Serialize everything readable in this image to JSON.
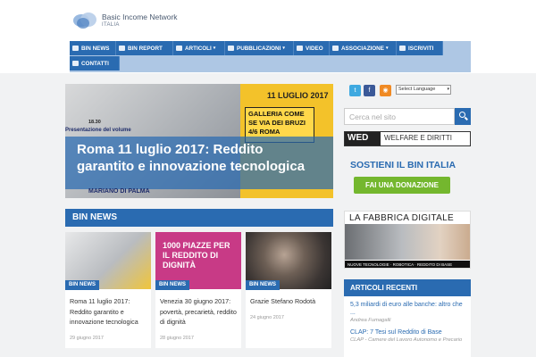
{
  "logo": {
    "line1": "Basic Income Network",
    "line2": "ITALIA"
  },
  "nav": {
    "items": [
      {
        "label": "BIN NEWS",
        "caret": ""
      },
      {
        "label": "BIN REPORT",
        "caret": ""
      },
      {
        "label": "ARTICOLI",
        "caret": "▾"
      },
      {
        "label": "PUBBLICAZIONI",
        "caret": "▾"
      },
      {
        "label": "VIDEO",
        "caret": ""
      },
      {
        "label": "ASSOCIAZIONE",
        "caret": "▾"
      },
      {
        "label": "ISCRIVITI",
        "caret": ""
      },
      {
        "label": "CONTATTI",
        "caret": ""
      }
    ]
  },
  "hero": {
    "title": "Roma 11 luglio 2017: Reddito garantito e innovazione tecnologica",
    "poster_date": "11 LUGLIO 2017",
    "poster_box": "GALLERIA COME SE VIA DEI BRUZI 4/6 ROMA",
    "poster_time": "18.30",
    "poster_line": "Presentazione del volume ",
    "poster_bottom": "MARIANO DI PALMA"
  },
  "section": {
    "bin_news": "BIN NEWS"
  },
  "cards": [
    {
      "tag": "BIN NEWS",
      "title": "Roma 11 luglio 2017: Reddito garantito e innovazione tecnologica",
      "date": "29 giugno 2017",
      "image": "poster-robot"
    },
    {
      "tag": "BIN NEWS",
      "title": "Venezia 30 giugno 2017: povertà, precarietà, reddito di dignità",
      "date": "28 giugno 2017",
      "image": "1000-piazze"
    },
    {
      "tag": "BIN NEWS",
      "title": "Grazie Stefano Rodotà",
      "date": "24 giugno 2017",
      "image": "portrait"
    }
  ],
  "card2_image_text": "1000 PIAZZE PER IL REDDITO DI DIGNITÀ",
  "sidebar": {
    "social": [
      {
        "icon": "twitter-icon",
        "glyph": "t",
        "color": "#3fa9e0"
      },
      {
        "icon": "facebook-icon",
        "glyph": "f",
        "color": "#3b5998"
      },
      {
        "icon": "rss-icon",
        "glyph": "◉",
        "color": "#f08a24"
      }
    ],
    "language": "Select Language",
    "search_placeholder": "Cerca nel sito",
    "wed_left": "WED",
    "wed_right": "WELFARE E DIRITTI",
    "sostieni": "SOSTIENI IL BIN ITALIA",
    "donate": "FAI UNA DONAZIONE",
    "fabbrica_title": "LA FABBRICA DIGITALE",
    "fabbrica_bar": "NUOVE TECNOLOGIE  ·  ROBOTICA  ·  REDDITO DI BASE",
    "recent_head": "ARTICOLI RECENTI",
    "recent": [
      {
        "title": "5,3 miliardi di euro alle banche: altro che ...",
        "author": "Andrea Fumagalli"
      },
      {
        "title": "CLAP: 7 Tesi sul Reddito di Base",
        "author": "CLAP - Camere del Lavoro Autonomo e Precario"
      }
    ]
  },
  "colors": {
    "accent": "#2a6bb1",
    "nav_bg": "#aec7e4",
    "donate": "#74b72e"
  }
}
